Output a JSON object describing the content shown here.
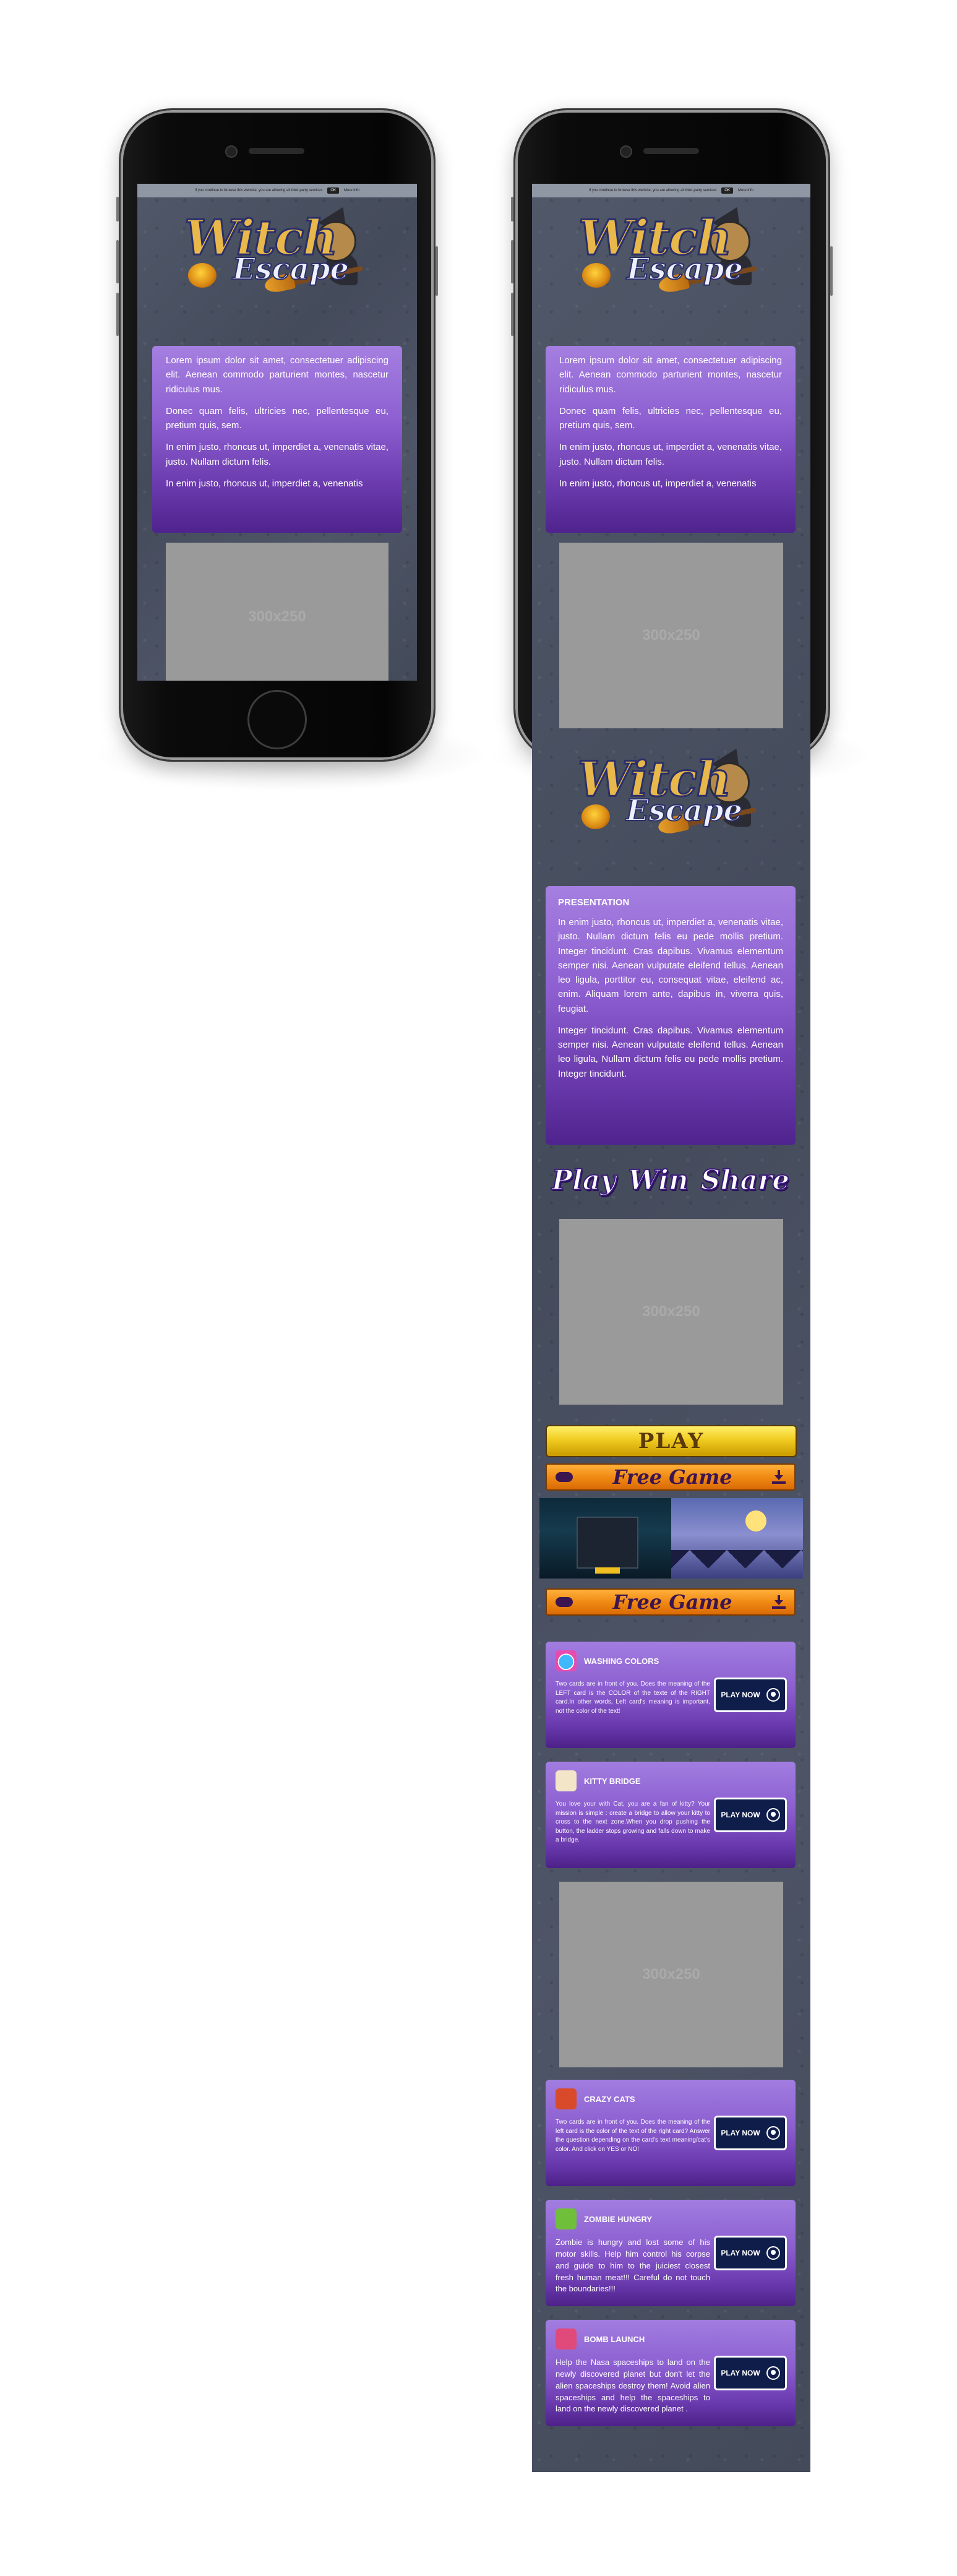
{
  "cookie_bar": {
    "text": "If you continue to browse this website, you are allowing all third-party services",
    "ok_label": "OK",
    "more_label": "More info"
  },
  "logo": {
    "word1": "Witch",
    "word2": "Escape"
  },
  "intro_card": {
    "paragraphs": [
      "Lorem ipsum dolor sit amet, consectetuer adipiscing elit. Aenean commodo parturient montes, nascetur ridiculus mus.",
      "Donec quam felis, ultricies nec, pellentesque eu, pretium quis, sem.",
      "In enim justo, rhoncus ut, imperdiet a, venenatis vitae, justo. Nullam dictum felis.",
      "In enim justo, rhoncus ut, imperdiet a, venenatis"
    ]
  },
  "ad_label": "300x250",
  "presentation": {
    "title": "PRESENTATION",
    "p1": "In enim justo, rhoncus ut, imperdiet a, venenatis vitae, justo. Nullam dictum felis eu pede mollis pretium. Integer tincidunt. Cras dapibus. Vivamus elementum semper nisi. Aenean vulputate eleifend tellus. Aenean leo ligula, porttitor eu, consequat vitae, eleifend ac, enim. Aliquam lorem ante, dapibus in, viverra quis, feugiat.",
    "p2": "Integer tincidunt. Cras dapibus. Vivamus elementum semper nisi. Aenean vulputate eleifend tellus. Aenean leo ligula, Nullam dictum felis eu pede mollis pretium. Integer tincidunt."
  },
  "tagline": {
    "play": "Play",
    "win": "Win",
    "share": "Share"
  },
  "play_banner": "PLAY",
  "free_game_label": "Free Game",
  "play_now_label": "PLAY NOW",
  "games": [
    {
      "title": "WASHING COLORS",
      "desc": "Two cards are in front of you. Does the meaning of the LEFT card is the COLOR of the texte of the RIGHT card.In other words, Left card's meaning is important, not the color of the text!",
      "icon_color": "#e84bb0"
    },
    {
      "title": "KITTY BRIDGE",
      "desc": "You love your with Cat, you are a fan of kitty? Your mission is simple : create a bridge to allow your kitty to cross to the next zone.When you drop pushing the button, the ladder stops growing and falls down to make a bridge.",
      "icon_color": "#f3e6c8"
    },
    {
      "title": "CRAZY CATS",
      "desc": "Two cards are in front of you. Does the meaning of the left card is the color of the text of the right card? Answer the question depending on the card's text meaning/cat's color. And click on YES or NO!",
      "icon_color": "#d94a2a"
    },
    {
      "title": "ZOMBIE HUNGRY",
      "desc": "Zombie is hungry and lost some of his motor skills. Help him control his corpse and guide to him to the juiciest closest fresh human meat!!! Careful do not touch the boundaries!!!",
      "icon_color": "#6fbf3a"
    },
    {
      "title": "BOMB LAUNCH",
      "desc": "Help the Nasa spaceships to land on the newly discovered planet but don't let the alien spaceships destroy them! Avoid alien spaceships and help the spaceships to land on the newly discovered planet .",
      "icon_color": "#e04a7a"
    }
  ]
}
